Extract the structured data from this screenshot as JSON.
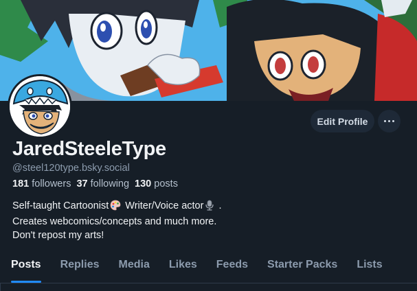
{
  "profile": {
    "display_name": "JaredSteeleType",
    "handle": "@steel120type.bsky.social",
    "followers_count": "181",
    "followers_label": "followers",
    "following_count": "37",
    "following_label": "following",
    "posts_count": "130",
    "posts_label": "posts",
    "bio": {
      "line1_a": "Self-taught Cartoonist",
      "line1_b": " Writer/Voice actor",
      "line1_c": " .",
      "line2": "Creates webcomics/concepts and much more.",
      "line3": "Don't repost my arts!"
    }
  },
  "actions": {
    "edit_profile_label": "Edit Profile",
    "more_icon": "ellipsis-icon"
  },
  "tabs": [
    {
      "label": "Posts",
      "active": true
    },
    {
      "label": "Replies"
    },
    {
      "label": "Media"
    },
    {
      "label": "Likes"
    },
    {
      "label": "Feeds"
    },
    {
      "label": "Starter Packs"
    },
    {
      "label": "Lists"
    }
  ],
  "colors": {
    "background": "#161e27",
    "accent": "#208bfe",
    "muted_text": "#8c9bad",
    "button_bg": "#1e2937"
  }
}
